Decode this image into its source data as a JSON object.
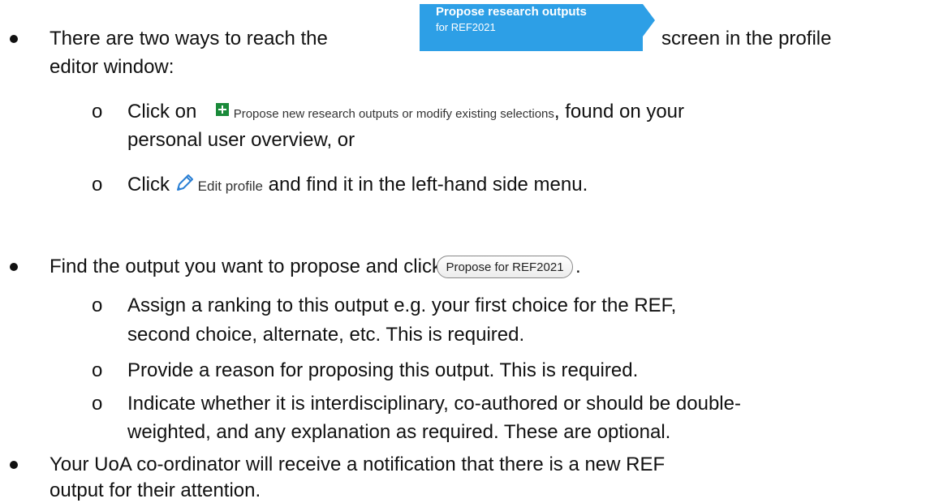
{
  "bullets": {
    "b1_text_before": "There are two ways to reach the",
    "b1_text_after": "screen in the profile",
    "b1_line2": "editor window:",
    "sub1_prefix": "Click on",
    "sub1_link": "Propose new research outputs or modify existing selections",
    "sub1_suffix": ", found on your",
    "sub1_line2": "personal user overview, or",
    "sub2_prefix": "Click",
    "sub2_edit_label": "Edit profile",
    "sub2_suffix": "and find it in the left-hand side menu.",
    "b2_text": "Find the output you want to propose and click",
    "b2_period": ".",
    "sub3_line1": "Assign a ranking to this output e.g. your first choice for the REF,",
    "sub3_line2": "second choice, alternate, etc. This is required.",
    "sub4": "Provide a reason for proposing this output. This is required.",
    "sub5_line1": "Indicate whether it is interdisciplinary, co-authored or should be double-",
    "sub5_line2": "weighted, and any explanation as required. These are optional.",
    "b3_line1": "Your UoA co-ordinator will receive a notification that there is a new REF",
    "b3_line2": "output for their attention.",
    "subbullet_marker": "o"
  },
  "tab_button": {
    "line1": "Propose research outputs",
    "line2": "for REF2021"
  },
  "propose_button_label": "Propose for REF2021",
  "colors": {
    "tab_blue": "#2d9fe6",
    "plus_green": "#1a8a3a",
    "pencil_blue": "#2a7fd4"
  }
}
